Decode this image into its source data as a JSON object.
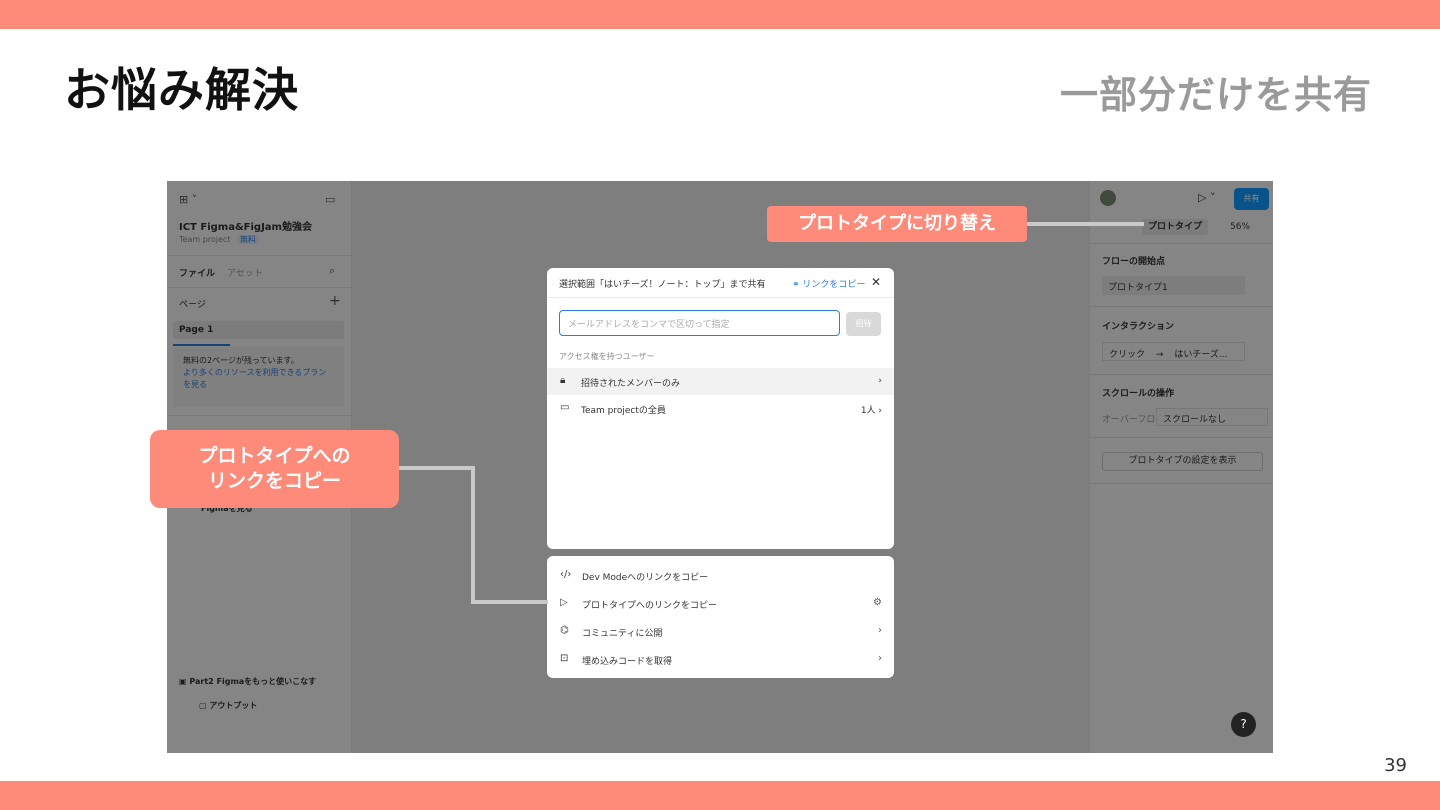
{
  "slide": {
    "title": "お悩み解決",
    "subtitle": "一部分だけを共有",
    "page_number": "39"
  },
  "left_panel": {
    "project_name": "ICT Figma&FigJam勉強会",
    "team": "Team project",
    "plan_badge": "無料",
    "tab_files": "ファイル",
    "tab_assets": "アセット",
    "pages_header": "ページ",
    "page_1": "Page 1",
    "notice_line1": "無料の2ページが残っています。",
    "notice_link": "より多くのリソースを利用できるプランを見る",
    "layer_item": "Figmaを見る",
    "part2": "Part2 Figmaをもっと使いこなす",
    "output": "アウトプット"
  },
  "right_panel": {
    "tab_prototype": "プロトタイプ",
    "zoom": "56%",
    "share_button": "共有",
    "flow_start_header": "フローの開始点",
    "flow_name": "プロトタイプ1",
    "interaction_header": "インタラクション",
    "interaction_trigger": "クリック",
    "interaction_arrow": "→",
    "interaction_target": "はいチーズ...",
    "scroll_header": "スクロールの操作",
    "overflow_label": "オーバーフロ",
    "overflow_value": "スクロールなし",
    "settings_button": "プロトタイプの設定を表示"
  },
  "share_modal": {
    "header": "選択範囲「はいチーズ！ノート：トップ」まで共有",
    "copy_link": "リンクをコピー",
    "email_placeholder": "メールアドレスをコンマで区切って指定",
    "invite_button": "招待",
    "access_header": "アクセス権を持つユーザー",
    "access_rows": [
      {
        "label": "招待されたメンバーのみ",
        "right": "›"
      },
      {
        "label": "Team projectの全員",
        "right": "1人 ›"
      }
    ]
  },
  "share_menu": {
    "items": [
      {
        "label": "Dev Modeへのリンクをコピー",
        "icon": "code-icon",
        "right": ""
      },
      {
        "label": "プロトタイプへのリンクをコピー",
        "icon": "play-icon",
        "right": "⚙"
      },
      {
        "label": "コミュニティに公開",
        "icon": "community-icon",
        "right": "›"
      },
      {
        "label": "埋め込みコードを取得",
        "icon": "embed-icon",
        "right": "›"
      }
    ]
  },
  "callouts": {
    "switch_prototype": "プロトタイプに切り替え",
    "copy_prototype_link_line1": "プロトタイプへの",
    "copy_prototype_link_line2": "リンクをコピー"
  },
  "help": "?",
  "colors": {
    "accent": "#fe8a7a",
    "figma_blue": "#0d99ff"
  }
}
